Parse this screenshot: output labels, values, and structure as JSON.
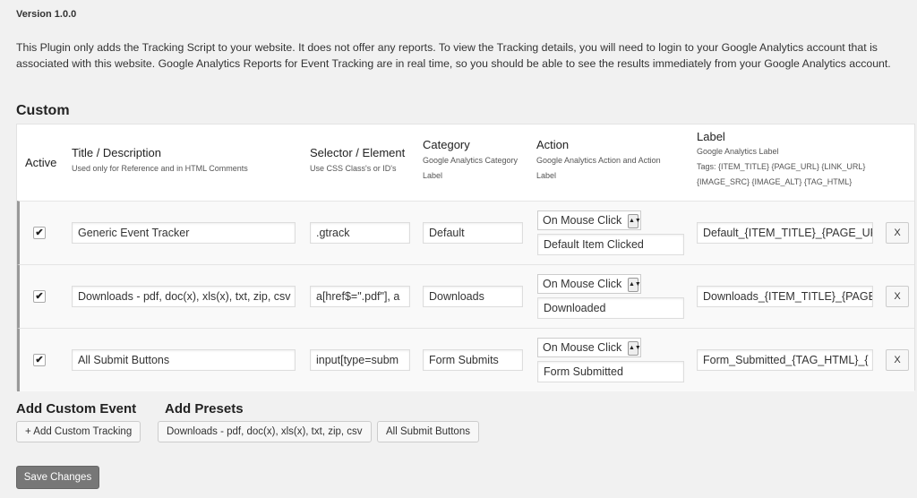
{
  "version": "Version 1.0.0",
  "description": "This Plugin only adds the Tracking Script to your website. It does not offer any reports. To view the Tracking details, you will need to login to your Google Analytics account that is associated with this website. Google Analytics Reports for Event Tracking are in real time, so you should be able to see the results immediately from your Google Analytics account.",
  "custom_title": "Custom",
  "headers": {
    "active": "Active",
    "title": "Title / Description",
    "title_sub": "Used only for Reference and in HTML Comments",
    "selector": "Selector / Element",
    "selector_sub": "Use CSS Class's or ID's",
    "category": "Category",
    "category_sub": "Google Analytics Category Label",
    "action": "Action",
    "action_sub": "Google Analytics Action and Action Label",
    "label": "Label",
    "label_sub": "Google Analytics Label",
    "label_tags": "Tags: {ITEM_TITLE} {PAGE_URL} {LINK_URL} {IMAGE_SRC} {IMAGE_ALT} {TAG_HTML}"
  },
  "rows": [
    {
      "checked": "✔",
      "title": "Generic Event Tracker",
      "selector": ".gtrack",
      "category": "Default",
      "action": "On Mouse Click",
      "action_label": "Default Item Clicked",
      "label": "Default_{ITEM_TITLE}_{PAGE_UR",
      "remove": "X"
    },
    {
      "checked": "✔",
      "title": "Downloads - pdf, doc(x), xls(x), txt, zip, csv",
      "selector": "a[href$=\".pdf\"], a",
      "category": "Downloads",
      "action": "On Mouse Click",
      "action_label": "Downloaded",
      "label": "Downloads_{ITEM_TITLE}_{PAGE",
      "remove": "X"
    },
    {
      "checked": "✔",
      "title": "All Submit Buttons",
      "selector": "input[type=subm",
      "category": "Form Submits",
      "action": "On Mouse Click",
      "action_label": "Form Submitted",
      "label": "Form_Submitted_{TAG_HTML}_{",
      "remove": "X"
    }
  ],
  "add_custom_title": "Add Custom Event",
  "add_custom_button": "+ Add Custom Tracking",
  "add_presets_title": "Add Presets",
  "presets": [
    "Downloads - pdf, doc(x), xls(x), txt, zip, csv",
    "All Submit Buttons"
  ],
  "save_button": "Save Changes",
  "dropdown_arrow": "▲▼"
}
